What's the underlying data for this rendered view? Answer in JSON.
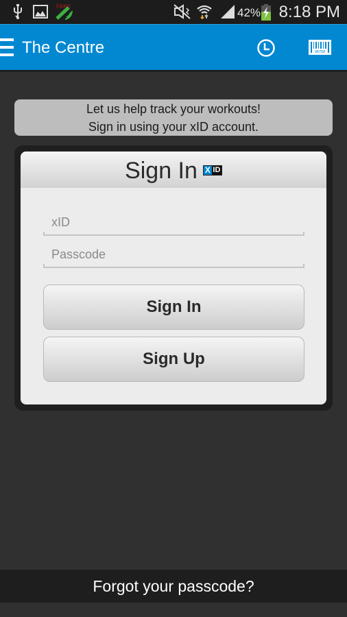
{
  "status_bar": {
    "time": "8:18 PM",
    "battery_percent": "42%",
    "icons": [
      "usb-icon",
      "gallery-icon",
      "fake-gps-icon",
      "mute-icon",
      "wifi-icon",
      "signal-icon",
      "battery-charging-icon"
    ],
    "fake_label": "FAKE"
  },
  "action_bar": {
    "title": "The Centre",
    "menu_icon": "hamburger-menu-icon",
    "actions": [
      {
        "name": "history",
        "icon": "clock-icon"
      },
      {
        "name": "barcode",
        "icon": "barcode-icon",
        "barcode_text": "98758"
      }
    ],
    "color": "#0288d1"
  },
  "banner": {
    "line1": "Let us help track your workouts!",
    "line2": "Sign in using your xID account."
  },
  "sign_in_card": {
    "title": "Sign In",
    "logo": {
      "x": "X",
      "id": "ID"
    },
    "xid_field": {
      "placeholder": "xID",
      "value": ""
    },
    "passcode_field": {
      "placeholder": "Passcode",
      "value": ""
    },
    "sign_in_button": "Sign In",
    "sign_up_button": "Sign Up"
  },
  "footer": {
    "forgot_link": "Forgot your passcode?"
  }
}
